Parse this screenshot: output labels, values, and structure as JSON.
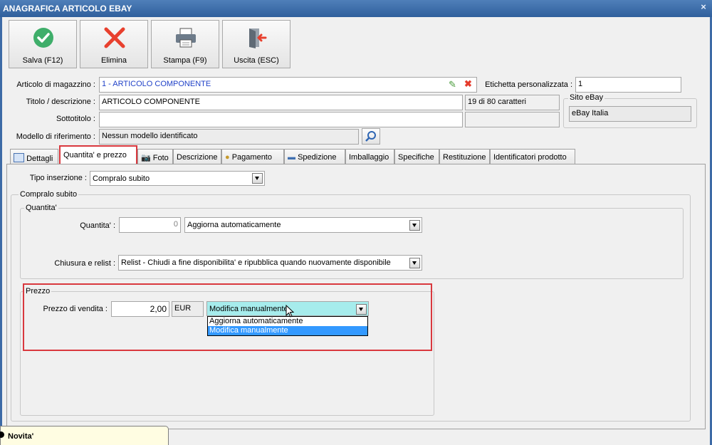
{
  "window": {
    "title": "ANAGRAFICA ARTICOLO EBAY",
    "close": "×"
  },
  "toolbar": {
    "save": "Salva (F12)",
    "delete": "Elimina",
    "print": "Stampa (F9)",
    "exit": "Uscita (ESC)"
  },
  "form": {
    "articolo_label": "Articolo di magazzino :",
    "articolo_value": "1 - ARTICOLO COMPONENTE",
    "etichetta_label": "Etichetta personalizzata :",
    "etichetta_value": "1",
    "titolo_label": "Titolo / descrizione :",
    "titolo_value": "ARTICOLO COMPONENTE",
    "char_count": "19 di 80 caratteri",
    "sottotitolo_label": "Sottotitolo :",
    "sottotitolo_value": "",
    "modello_label": "Modello di riferimento :",
    "modello_value": "Nessun modello identificato",
    "sito_title": "Sito eBay",
    "sito_value": "eBay Italia"
  },
  "tabs": [
    {
      "label": "Dettagli"
    },
    {
      "label": "Quantita' e prezzo"
    },
    {
      "label": "Foto"
    },
    {
      "label": "Descrizione"
    },
    {
      "label": "Pagamento"
    },
    {
      "label": "Spedizione"
    },
    {
      "label": "Imballaggio"
    },
    {
      "label": "Specifiche"
    },
    {
      "label": "Restituzione"
    },
    {
      "label": "Identificatori prodotto"
    }
  ],
  "qp": {
    "tipo_label": "Tipo inserzione :",
    "tipo_value": "Compralo subito",
    "compralo_title": "Compralo subito",
    "quantita_group": "Quantita'",
    "quantita_label": "Quantita' :",
    "quantita_value": "0",
    "quantita_mode": "Aggiorna automaticamente",
    "chiusura_label": "Chiusura e relist :",
    "chiusura_value": "Relist - Chiudi a fine disponibilita' e ripubblica quando nuovamente disponibile",
    "prezzo_group": "Prezzo",
    "prezzo_label": "Prezzo di vendita :",
    "prezzo_value": "2,00",
    "currency": "EUR",
    "prezzo_mode": "Modifica manualmente",
    "dropdown_options": [
      "Aggiorna automaticamente",
      "Modifica manualmente"
    ]
  },
  "footer": {
    "novita": "Novita'"
  },
  "colors": {
    "accent": "#3d6ba6",
    "highlight": "#d9383e",
    "selection": "#3399ff",
    "combo_open": "#a6ecec"
  }
}
